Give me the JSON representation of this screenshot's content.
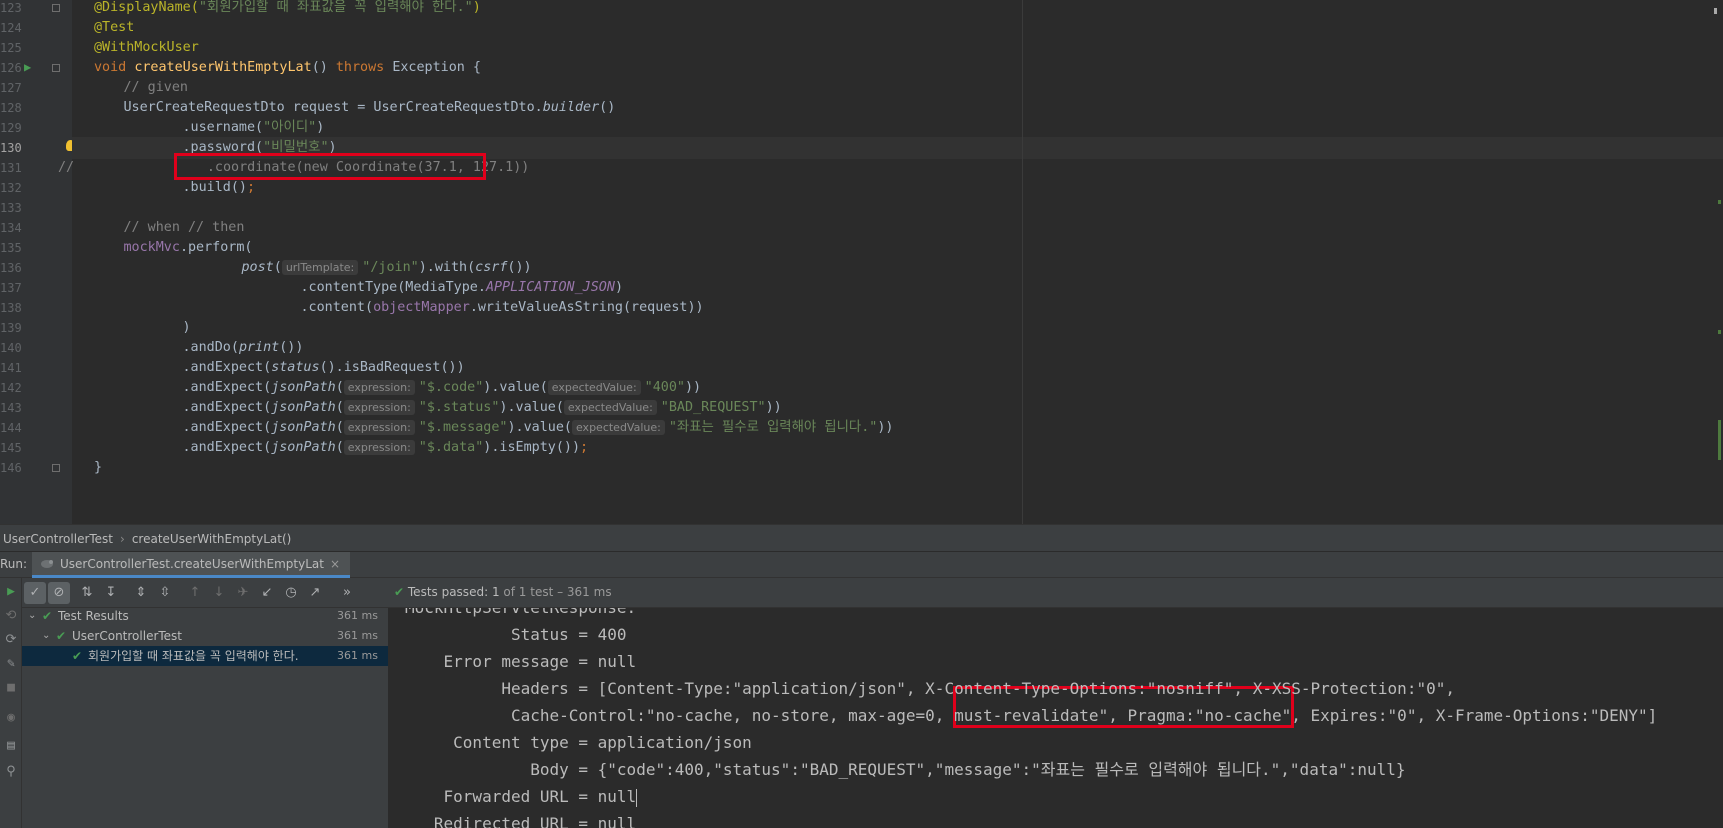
{
  "editor": {
    "gutter": [
      {
        "num": "123",
        "fold": true
      },
      {
        "num": "124",
        "fold": false
      },
      {
        "num": "125",
        "fold": false
      },
      {
        "num": "126",
        "fold": true,
        "run": true
      },
      {
        "num": "127",
        "fold": false
      },
      {
        "num": "128",
        "fold": false
      },
      {
        "num": "129",
        "fold": false
      },
      {
        "num": "130",
        "fold": false,
        "bulb": true
      },
      {
        "num": "131",
        "fold": false
      },
      {
        "num": "132",
        "fold": false
      },
      {
        "num": "133",
        "fold": false
      },
      {
        "num": "134",
        "fold": false
      },
      {
        "num": "135",
        "fold": false
      },
      {
        "num": "136",
        "fold": false
      },
      {
        "num": "137",
        "fold": false
      },
      {
        "num": "138",
        "fold": false
      },
      {
        "num": "139",
        "fold": false
      },
      {
        "num": "140",
        "fold": false
      },
      {
        "num": "141",
        "fold": false
      },
      {
        "num": "142",
        "fold": false
      },
      {
        "num": "143",
        "fold": false
      },
      {
        "num": "144",
        "fold": false
      },
      {
        "num": "145",
        "fold": false
      },
      {
        "num": "146",
        "fold": true
      }
    ],
    "lines": [
      {
        "indent": 1,
        "segs": [
          [
            "ann",
            "@DisplayName("
          ],
          [
            "str",
            "\"회원가입할 때 좌표값을 꼭 입력해야 한다.\""
          ],
          [
            "ann",
            ")"
          ]
        ]
      },
      {
        "indent": 1,
        "segs": [
          [
            "ann",
            "@Test"
          ]
        ]
      },
      {
        "indent": 1,
        "segs": [
          [
            "ann",
            "@WithMockUser"
          ]
        ]
      },
      {
        "indent": 1,
        "segs": [
          [
            "kw",
            "void "
          ],
          [
            "fn",
            "createUserWithEmptyLat"
          ],
          [
            "",
            "() "
          ],
          [
            "kw",
            "throws "
          ],
          [
            "",
            "Exception {"
          ]
        ]
      },
      {
        "indent": 2,
        "segs": [
          [
            "cmt",
            "// given"
          ]
        ]
      },
      {
        "indent": 2,
        "segs": [
          [
            "",
            "UserCreateRequestDto request = UserCreateRequestDto."
          ],
          [
            "it",
            "builder"
          ],
          [
            "",
            "()"
          ]
        ]
      },
      {
        "indent": 4,
        "segs": [
          [
            "",
            ".username("
          ],
          [
            "str",
            "\"아이디\""
          ],
          [
            "",
            ")"
          ]
        ]
      },
      {
        "indent": 4,
        "cur": true,
        "segs": [
          [
            "",
            ".password("
          ],
          [
            "str",
            "\"비밀번호\""
          ],
          [
            "",
            ")"
          ]
        ]
      },
      {
        "indent": 0,
        "prefix": "//",
        "segs": [
          [
            "cmt",
            "              .coordinate(new Coordinate(37.1, 127.1))"
          ]
        ]
      },
      {
        "indent": 4,
        "segs": [
          [
            "",
            ".build()"
          ],
          [
            "kw",
            ";"
          ]
        ]
      },
      {
        "indent": 0,
        "segs": []
      },
      {
        "indent": 2,
        "segs": [
          [
            "cmt",
            "// when // then"
          ]
        ]
      },
      {
        "indent": 2,
        "segs": [
          [
            "var",
            "mockMvc"
          ],
          [
            "",
            ".perform("
          ]
        ]
      },
      {
        "indent": 6,
        "segs": [
          [
            "it",
            "post"
          ],
          [
            "",
            "("
          ],
          [
            "hint",
            "urlTemplate:"
          ],
          [
            "str",
            "\"/join\""
          ],
          [
            "",
            ").with("
          ],
          [
            "it",
            "csrf"
          ],
          [
            "",
            "())"
          ]
        ]
      },
      {
        "indent": 8,
        "segs": [
          [
            "",
            ".contentType(MediaType."
          ],
          [
            "fld",
            "APPLICATION_JSON"
          ],
          [
            "",
            ")"
          ]
        ]
      },
      {
        "indent": 8,
        "segs": [
          [
            "",
            ".content("
          ],
          [
            "var",
            "objectMapper"
          ],
          [
            "",
            ".writeValueAsString(request))"
          ]
        ]
      },
      {
        "indent": 4,
        "segs": [
          [
            "",
            ")"
          ]
        ]
      },
      {
        "indent": 4,
        "segs": [
          [
            "",
            ".andDo("
          ],
          [
            "it",
            "print"
          ],
          [
            "",
            "())"
          ]
        ]
      },
      {
        "indent": 4,
        "segs": [
          [
            "",
            ".andExpect("
          ],
          [
            "it",
            "status"
          ],
          [
            "",
            "().isBadRequest())"
          ]
        ]
      },
      {
        "indent": 4,
        "segs": [
          [
            "",
            ".andExpect("
          ],
          [
            "it",
            "jsonPath"
          ],
          [
            "",
            "("
          ],
          [
            "hint",
            "expression:"
          ],
          [
            "str",
            "\"$.code\""
          ],
          [
            "",
            ").value("
          ],
          [
            "hint",
            "expectedValue:"
          ],
          [
            "str",
            "\"400\""
          ],
          [
            "",
            "))"
          ]
        ]
      },
      {
        "indent": 4,
        "segs": [
          [
            "",
            ".andExpect("
          ],
          [
            "it",
            "jsonPath"
          ],
          [
            "",
            "("
          ],
          [
            "hint",
            "expression:"
          ],
          [
            "str",
            "\"$.status\""
          ],
          [
            "",
            ").value("
          ],
          [
            "hint",
            "expectedValue:"
          ],
          [
            "str",
            "\"BAD_REQUEST\""
          ],
          [
            "",
            "))"
          ]
        ]
      },
      {
        "indent": 4,
        "segs": [
          [
            "",
            ".andExpect("
          ],
          [
            "it",
            "jsonPath"
          ],
          [
            "",
            "("
          ],
          [
            "hint",
            "expression:"
          ],
          [
            "str",
            "\"$.message\""
          ],
          [
            "",
            ").value("
          ],
          [
            "hint",
            "expectedValue:"
          ],
          [
            "str",
            "\"좌표는 필수로 입력해야 됩니다.\""
          ],
          [
            "",
            "))"
          ]
        ]
      },
      {
        "indent": 4,
        "segs": [
          [
            "",
            ".andExpect("
          ],
          [
            "it",
            "jsonPath"
          ],
          [
            "",
            "("
          ],
          [
            "hint",
            "expression:"
          ],
          [
            "str",
            "\"$.data\""
          ],
          [
            "",
            ").isEmpty())"
          ],
          [
            "kw",
            ";"
          ]
        ]
      },
      {
        "indent": 1,
        "segs": [
          [
            "",
            "}"
          ]
        ]
      }
    ]
  },
  "breadcrumb": {
    "class_name": "UserControllerTest",
    "method_name": "createUserWithEmptyLat()"
  },
  "run": {
    "label": "Run:",
    "tab_label": "UserControllerTest.createUserWithEmptyLat",
    "tab_close": "×",
    "status_passed": "Tests passed:",
    "status_count": "1",
    "status_rest": "of 1 test – 361 ms",
    "more": "»"
  },
  "tree": [
    {
      "level": 0,
      "label": "Test Results",
      "time": "361 ms",
      "arrow": true,
      "sel": false
    },
    {
      "level": 1,
      "label": "UserControllerTest",
      "time": "361 ms",
      "arrow": true,
      "sel": false
    },
    {
      "level": 2,
      "label": "회원가입할 때 좌표값을 꼭 입력해야 한다.",
      "time": "361 ms",
      "arrow": false,
      "sel": true
    }
  ],
  "console": [
    "MockHttpServletResponse:",
    "           Status = 400",
    "    Error message = null",
    "          Headers = [Content-Type:\"application/json\", X-Content-Type-Options:\"nosniff\", X-XSS-Protection:\"0\",",
    "           Cache-Control:\"no-cache, no-store, max-age=0, must-revalidate\", Pragma:\"no-cache\", Expires:\"0\", X-Frame-Options:\"DENY\"]",
    "     Content type = application/json",
    "             Body = {\"code\":400,\"status\":\"BAD_REQUEST\",\"message\":\"좌표는 필수로 입력해야 됩니다.\",\"data\":null}",
    "    Forwarded URL = null",
    "   Redirected URL = null"
  ]
}
